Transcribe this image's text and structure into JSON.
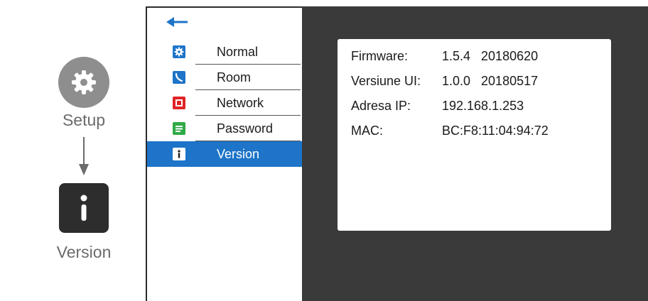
{
  "guide": {
    "setup_label": "Setup",
    "version_label": "Version",
    "setup_icon": "gear-icon",
    "version_icon": "info-icon"
  },
  "menu": {
    "back_icon": "back-arrow-icon",
    "items": [
      {
        "label": "Normal",
        "icon": "gear-icon",
        "icon_color": "#1d74c8",
        "active": false
      },
      {
        "label": "Room",
        "icon": "phone-icon",
        "icon_color": "#1d74c8",
        "active": false
      },
      {
        "label": "Network",
        "icon": "network-icon",
        "icon_color": "#e02424",
        "active": false
      },
      {
        "label": "Password",
        "icon": "password-icon",
        "icon_color": "#2eaa46",
        "active": false
      },
      {
        "label": "Version",
        "icon": "info-icon",
        "icon_color": "#ffffff",
        "active": true
      }
    ]
  },
  "info": {
    "rows": [
      {
        "key": "Firmware:",
        "value": "1.5.4   20180620"
      },
      {
        "key": "Versiune UI:",
        "value": "1.0.0   20180517"
      },
      {
        "key": "Adresa IP:",
        "value": "192.168.1.253"
      },
      {
        "key": "MAC:",
        "value": "BC:F8:11:04:94:72"
      }
    ]
  },
  "colors": {
    "accent": "#1d74c8",
    "screen_bg": "#3a3a3a",
    "guide_gray": "#8e8e8e"
  }
}
